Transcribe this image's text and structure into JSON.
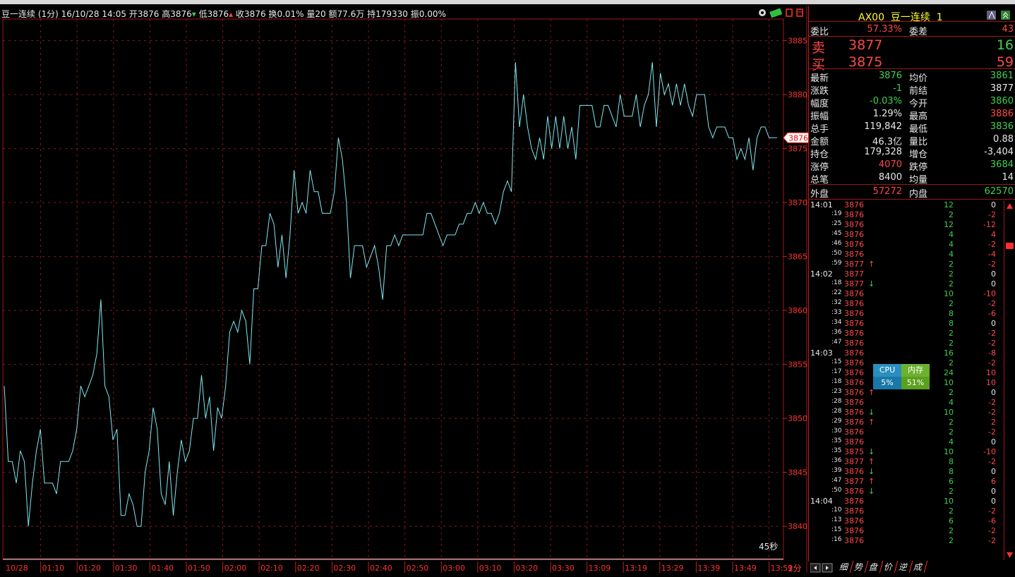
{
  "title_bar": {
    "name": "豆一连续",
    "period": "(1分)",
    "datetime": "16/10/28 14:05",
    "open_label": "开",
    "open": "3876",
    "high_label": "高",
    "high": "3876",
    "low_label": "低",
    "low": "3876",
    "close_label": "收",
    "close": "3876",
    "turnover_label": "换",
    "turnover": "0.01%",
    "volume_label": "量",
    "volume": "20",
    "amount_label": "额",
    "amount": "77.6万",
    "oi_label": "持",
    "oi": "179330",
    "amplitude_label": "振",
    "amplitude": "0.00%"
  },
  "countdown": "45秒",
  "period_label": "1分",
  "chart_data": {
    "type": "line",
    "ylim": [
      3837,
      3887
    ],
    "y_ticks": [
      "3885",
      "3880",
      "3875",
      "3870",
      "3865",
      "3860",
      "3855",
      "3850",
      "3845",
      "3840"
    ],
    "x_ticks": [
      "10/28",
      "01:10",
      "01:20",
      "01:30",
      "01:40",
      "01:50",
      "02:00",
      "02:10",
      "02:20",
      "02:30",
      "02:40",
      "02:50",
      "03:00",
      "03:10",
      "03:20",
      "03:30",
      "13:09",
      "13:19",
      "13:29",
      "13:39",
      "13:49",
      "13:59"
    ],
    "current_price": "3876",
    "line_color": "#7fe8f0",
    "values": [
      3853,
      3846,
      3846,
      3844,
      3847,
      3846,
      3840,
      3844,
      3847,
      3849,
      3844,
      3844,
      3844,
      3843,
      3846,
      3846,
      3846,
      3847,
      3849,
      3853,
      3852,
      3853,
      3854,
      3856,
      3861,
      3853,
      3852,
      3848,
      3849,
      3841,
      3841,
      3843,
      3842,
      3840,
      3840,
      3845,
      3847,
      3851,
      3849,
      3843,
      3842,
      3846,
      3841,
      3845,
      3848,
      3846,
      3847,
      3850,
      3850,
      3854,
      3850,
      3852,
      3847,
      3851,
      3850,
      3853,
      3858,
      3859,
      3858,
      3860,
      3859,
      3855,
      3862,
      3862,
      3866,
      3866,
      3869,
      3868,
      3864,
      3867,
      3863,
      3867,
      3873,
      3869,
      3870,
      3869,
      3873,
      3871,
      3871,
      3869,
      3869,
      3869,
      3871,
      3876,
      3874,
      3870,
      3863,
      3866,
      3866,
      3866,
      3864,
      3865,
      3866,
      3864,
      3861,
      3866,
      3866,
      3867,
      3866,
      3867,
      3867,
      3867,
      3867,
      3867,
      3867,
      3869,
      3869,
      3868,
      3867,
      3866,
      3867,
      3867,
      3867,
      3868,
      3868,
      3869,
      3869,
      3870,
      3869,
      3870,
      3869,
      3869,
      3868,
      3869,
      3871,
      3872,
      3871,
      3883,
      3877,
      3880,
      3877,
      3875,
      3874,
      3876,
      3874,
      3878,
      3875,
      3878,
      3875,
      3878,
      3875,
      3877,
      3874,
      3879,
      3879,
      3879,
      3879,
      3877,
      3877,
      3879,
      3879,
      3878,
      3877,
      3880,
      3878,
      3878,
      3878,
      3880,
      3877,
      3879,
      3880,
      3883,
      3877,
      3882,
      3880,
      3881,
      3879,
      3881,
      3879,
      3881,
      3879,
      3878,
      3880,
      3880,
      3880,
      3877,
      3876,
      3877,
      3877,
      3877,
      3876,
      3876,
      3874,
      3875,
      3874,
      3876,
      3873,
      3876,
      3877,
      3877,
      3876,
      3876,
      3876
    ]
  },
  "quote": {
    "code": "AX00",
    "name": "豆一连续",
    "suffix": "1",
    "weibi_label": "委比",
    "weibi": "57.33%",
    "weicha_label": "委差",
    "weicha": "43",
    "sell_label": "卖",
    "sell_price": "3877",
    "sell_vol": "16",
    "buy_label": "买",
    "buy_price": "3875",
    "buy_vol": "59",
    "rows": [
      {
        "l1": "最新",
        "v1": "3876",
        "c1": "grn",
        "l2": "均价",
        "v2": "3861",
        "c2": "grn"
      },
      {
        "l1": "涨跌",
        "v1": "-1",
        "c1": "grn",
        "l2": "前结",
        "v2": "3877",
        "c2": "wht"
      },
      {
        "l1": "幅度",
        "v1": "-0.03%",
        "c1": "grn",
        "l2": "今开",
        "v2": "3860",
        "c2": "grn"
      },
      {
        "l1": "振幅",
        "v1": "1.29%",
        "c1": "wht",
        "l2": "最高",
        "v2": "3886",
        "c2": "red"
      },
      {
        "l1": "总手",
        "v1": "119,842",
        "c1": "wht",
        "l2": "最低",
        "v2": "3836",
        "c2": "grn"
      },
      {
        "l1": "金额",
        "v1": "46.3亿",
        "c1": "wht",
        "l2": "量比",
        "v2": "0.88",
        "c2": "wht"
      },
      {
        "l1": "持仓",
        "v1": "179,328",
        "c1": "wht",
        "l2": "增仓",
        "v2": "-3,404",
        "c2": "wht"
      },
      {
        "l1": "涨停",
        "v1": "4070",
        "c1": "red",
        "l2": "跌停",
        "v2": "3684",
        "c2": "grn"
      },
      {
        "l1": "总笔",
        "v1": "8400",
        "c1": "wht",
        "l2": "均量",
        "v2": "14",
        "c2": "wht"
      }
    ],
    "outer_label": "外盘",
    "outer": "57272",
    "inner_label": "内盘",
    "inner": "62570"
  },
  "ticks": [
    {
      "t": "14:01",
      "p": "3876",
      "a": "",
      "v": "12",
      "d": "0"
    },
    {
      "t": ":19",
      "p": "3876",
      "a": "",
      "v": "2",
      "d": "-2"
    },
    {
      "t": ":25",
      "p": "3876",
      "a": "",
      "v": "12",
      "d": "-12"
    },
    {
      "t": ":45",
      "p": "3876",
      "a": "",
      "v": "4",
      "d": "4"
    },
    {
      "t": ":46",
      "p": "3876",
      "a": "",
      "v": "4",
      "d": "-2"
    },
    {
      "t": ":50",
      "p": "3876",
      "a": "",
      "v": "4",
      "d": "-4"
    },
    {
      "t": ":59",
      "p": "3877",
      "a": "↑",
      "v": "2",
      "d": "-2"
    },
    {
      "t": "14:02",
      "p": "3877",
      "a": "",
      "v": "2",
      "d": "0"
    },
    {
      "t": ":18",
      "p": "3877",
      "a": "↓",
      "v": "2",
      "d": "0"
    },
    {
      "t": ":22",
      "p": "3876",
      "a": "",
      "v": "10",
      "d": "-10"
    },
    {
      "t": ":32",
      "p": "3876",
      "a": "",
      "v": "2",
      "d": "-2"
    },
    {
      "t": ":33",
      "p": "3876",
      "a": "",
      "v": "8",
      "d": "-6"
    },
    {
      "t": ":34",
      "p": "3876",
      "a": "",
      "v": "8",
      "d": "0"
    },
    {
      "t": ":36",
      "p": "3876",
      "a": "",
      "v": "2",
      "d": "-2"
    },
    {
      "t": ":47",
      "p": "3876",
      "a": "",
      "v": "2",
      "d": "-2"
    },
    {
      "t": "14:03",
      "p": "3876",
      "a": "",
      "v": "16",
      "d": "-8"
    },
    {
      "t": ":15",
      "p": "3876",
      "a": "",
      "v": "2",
      "d": "-2"
    },
    {
      "t": ":17",
      "p": "3876",
      "a": "",
      "v": "24",
      "d": "10"
    },
    {
      "t": ":18",
      "p": "3876",
      "a": "",
      "v": "10",
      "d": "10"
    },
    {
      "t": ":23",
      "p": "3876",
      "a": "↑",
      "v": "2",
      "d": "0"
    },
    {
      "t": ":28",
      "p": "3876",
      "a": "",
      "v": "4",
      "d": "-2"
    },
    {
      "t": ":28",
      "p": "3876",
      "a": "↓",
      "v": "10",
      "d": "-2"
    },
    {
      "t": ":29",
      "p": "3876",
      "a": "↑",
      "v": "2",
      "d": "2"
    },
    {
      "t": ":30",
      "p": "3876",
      "a": "",
      "v": "2",
      "d": "-2"
    },
    {
      "t": ":35",
      "p": "3876",
      "a": "",
      "v": "4",
      "d": "0"
    },
    {
      "t": ":35",
      "p": "3875",
      "a": "↓",
      "v": "10",
      "d": "-10"
    },
    {
      "t": ":36",
      "p": "3877",
      "a": "↑",
      "v": "8",
      "d": "-2"
    },
    {
      "t": ":39",
      "p": "3876",
      "a": "↓",
      "v": "8",
      "d": "0"
    },
    {
      "t": ":47",
      "p": "3877",
      "a": "↑",
      "v": "6",
      "d": "6"
    },
    {
      "t": ":50",
      "p": "3876",
      "a": "↓",
      "v": "2",
      "d": "0"
    },
    {
      "t": "14:04",
      "p": "3876",
      "a": "",
      "v": "10",
      "d": "0"
    },
    {
      "t": ":10",
      "p": "3876",
      "a": "",
      "v": "2",
      "d": "-2"
    },
    {
      "t": ":13",
      "p": "3876",
      "a": "",
      "v": "6",
      "d": "-6"
    },
    {
      "t": ":15",
      "p": "3876",
      "a": "",
      "v": "2",
      "d": "-2"
    },
    {
      "t": ":16",
      "p": "3876",
      "a": "",
      "v": "2",
      "d": "-2"
    }
  ],
  "widget": {
    "cpu_label": "CPU",
    "mem_label": "内存",
    "cpu": "5%",
    "mem": "51%"
  },
  "tabs": [
    "细",
    "势",
    "盘",
    "价",
    "逆",
    "成"
  ]
}
